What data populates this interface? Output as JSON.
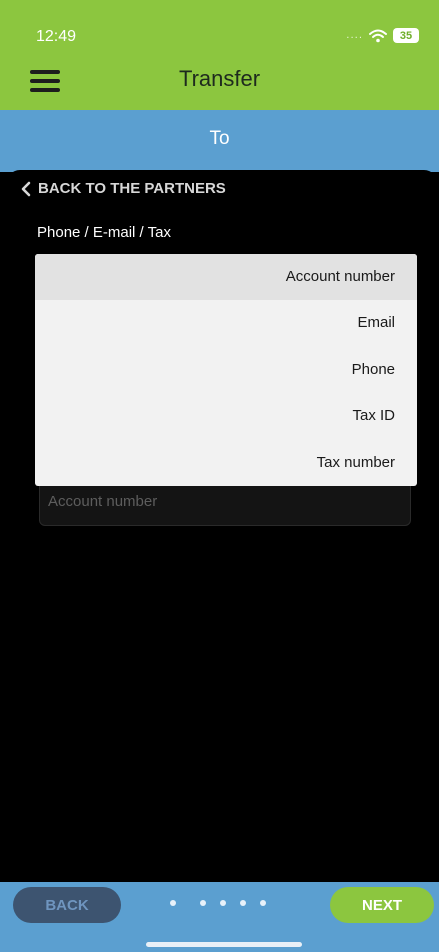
{
  "status_bar": {
    "time": "12:49",
    "signal_dots": "....",
    "wifi_icon": "wifi-icon",
    "battery_level": "35"
  },
  "header": {
    "menu_icon": "hamburger-menu-icon",
    "title": "Transfer"
  },
  "step": {
    "title": "To"
  },
  "content": {
    "back_link": "BACK TO THE PARTNERS",
    "field_label": "Phone / E-mail / Tax",
    "account_input": {
      "placeholder": "Account number",
      "value": ""
    }
  },
  "dropdown": {
    "options": [
      {
        "label": "Account number",
        "selected": true
      },
      {
        "label": "Email",
        "selected": false
      },
      {
        "label": "Phone",
        "selected": false
      },
      {
        "label": "Tax ID",
        "selected": false
      },
      {
        "label": "Tax number",
        "selected": false
      }
    ]
  },
  "navigation": {
    "back_label": "BACK",
    "next_label": "NEXT",
    "step_count": 5
  },
  "colors": {
    "header_green": "#8cc63f",
    "step_blue": "#5b9fd0",
    "back_button": "#3d5470",
    "next_button": "#8cc63f",
    "background": "#000000"
  }
}
